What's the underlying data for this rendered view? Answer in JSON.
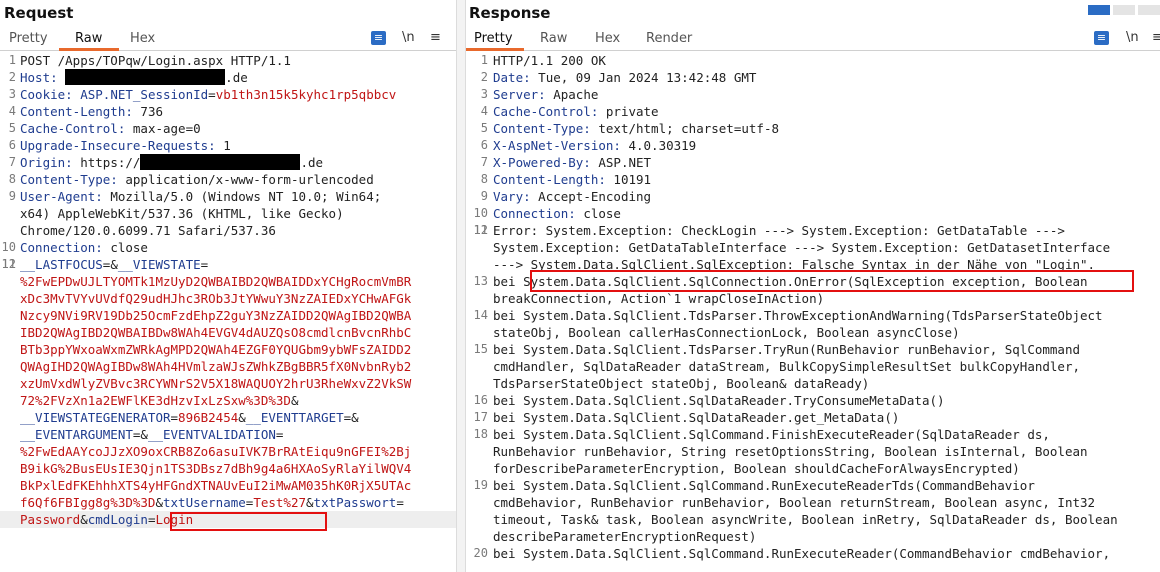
{
  "request": {
    "title": "Request",
    "tabs": [
      "Pretty",
      "Raw",
      "Hex"
    ],
    "active_tab": "Raw",
    "lines": {
      "l1": "POST /Apps/TOPqw/Login.aspx HTTP/1.1",
      "l2_name": "Host:",
      "l2_suffix": ".de",
      "l3_name": "Cookie:",
      "l3_cookie_name": "ASP.NET_SessionId",
      "l3_cookie_value": "vb1th3n15k5kyhc1rp5qbbcv",
      "l4_name": "Content-Length:",
      "l4_value": "736",
      "l5_name": "Cache-Control:",
      "l5_value": "max-age=0",
      "l6_name": "Upgrade-Insecure-Requests:",
      "l6_value": "1",
      "l7_name": "Origin:",
      "l7_prefix": "https://",
      "l7_suffix": ".de",
      "l8_name": "Content-Type:",
      "l8_value": "application/x-www-form-urlencoded",
      "l9_name": "User-Agent:",
      "l9_value_a": "Mozilla/5.0 (Windows NT 10.0; Win64;",
      "l9_value_b": "x64) AppleWebKit/537.36 (KHTML, like Gecko)",
      "l9_value_c": "Chrome/120.0.6099.71 Safari/537.36",
      "l10_name": "Connection:",
      "l10_value": "close",
      "body": {
        "lastfocus": "__LASTFOCUS",
        "viewstate_key": "__VIEWSTATE",
        "vs1": "%2FwEPDwUJLTYOMTk1MzUyD2QWBAIBD2QWBAIDDxYCHgRocmVmBR",
        "vs2": "xDc3MvTVYvUVdfQ29udHJhc3ROb3JtYWwuY3NzZAIEDxYCHwAFGk",
        "vs3": "Nzcy9NVi9RV19Db25OcmFzdEhpZ2guY3NzZAIDD2QWAgIBD2QWBA",
        "vs4": "IBD2QWAgIBD2QWBAIBDw8WAh4EVGV4dAUZQsO8cmdlcnBvcnRhbC",
        "vs5": "BTb3ppYWxoaWxmZWRkAgMPD2QWAh4EZGF0YQUGbm9ybWFsZAIDD2",
        "vs6": "QWAgIHD2QWAgIBDw8WAh4HVmlzaWJsZWhkZBgBBR5fX0NvbnRyb2",
        "vs7": "xzUmVxdWlyZVBvc3RCYWNrS2V5X18WAQUOY2hrU3RheWxvZ2VkSW",
        "vs8": "72%2FVzXn1a2EWFlKE3dHzvIxLzSxw%3D%3D",
        "vsgen_key": "__VIEWSTATEGENERATOR",
        "vsgen_value": "896B2454",
        "evtarget_key": "__EVENTTARGET",
        "evarg_key": "__EVENTARGUMENT",
        "evval_key": "__EVENTVALIDATION",
        "ev1": "%2FwEdAAYcoJJzXO9oxCRB8Zo6asuIVK7BrRAtEiqu9nGFEI%2Bj",
        "ev2": "B9ikG%2BusEUsIE3Qjn1TS3DBsz7dBh9g4a6HXAoSyRlaYilWQV4",
        "ev3": "BkPxlEdFKEhhhXTS4yHFGndXTNAUvEuI2iMwAM035hK0RjX5UTAc",
        "ev4": "f6Qf6FBIgg8g%3D%3D",
        "user_key": "txtUsername",
        "user_value": "Test%27",
        "pass_key": "txtPasswort",
        "pass_value": "Password",
        "login_key": "cmdLogin",
        "login_value": "Login"
      }
    }
  },
  "response": {
    "title": "Response",
    "tabs": [
      "Pretty",
      "Raw",
      "Hex",
      "Render"
    ],
    "active_tab": "Pretty",
    "headers": [
      {
        "n": "1",
        "text": "HTTP/1.1 200 OK"
      },
      {
        "n": "2",
        "name": "Date:",
        "value": "Tue, 09 Jan 2024 13:42:48 GMT"
      },
      {
        "n": "3",
        "name": "Server:",
        "value": "Apache"
      },
      {
        "n": "4",
        "name": "Cache-Control:",
        "value": "private"
      },
      {
        "n": "5",
        "name": "Content-Type:",
        "value": "text/html; charset=utf-8"
      },
      {
        "n": "6",
        "name": "X-AspNet-Version:",
        "value": "4.0.30319"
      },
      {
        "n": "7",
        "name": "X-Powered-By:",
        "value": "ASP.NET"
      },
      {
        "n": "8",
        "name": "Content-Length:",
        "value": "10191"
      },
      {
        "n": "9",
        "name": "Vary:",
        "value": "Accept-Encoding"
      },
      {
        "n": "10",
        "name": "Connection:",
        "value": "close"
      }
    ],
    "error_a": "Error: System.Exception: CheckLogin ---> System.Exception: GetDataTable --->",
    "error_b": "System.Exception: GetDataTableInterface ---> System.Exception: GetDatasetInterface",
    "error_c_prefix": "--->",
    "error_c_sql": "System.Data.SqlClient.SqlException: Falsche Syntax in der Nähe von \"Login\".",
    "s13a": "bei System.Data.SqlClient.SqlConnection.OnError(SqlException exception, Boolean",
    "s13b": "breakConnection, Action`1 wrapCloseInAction)",
    "s14a": "bei System.Data.SqlClient.TdsParser.ThrowExceptionAndWarning(TdsParserStateObject",
    "s14b": "stateObj, Boolean callerHasConnectionLock, Boolean asyncClose)",
    "s15a": "bei System.Data.SqlClient.TdsParser.TryRun(RunBehavior runBehavior, SqlCommand",
    "s15b": "cmdHandler, SqlDataReader dataStream, BulkCopySimpleResultSet bulkCopyHandler,",
    "s15c": "TdsParserStateObject stateObj, Boolean& dataReady)",
    "s16": "bei System.Data.SqlClient.SqlDataReader.TryConsumeMetaData()",
    "s17": "bei System.Data.SqlClient.SqlDataReader.get_MetaData()",
    "s18a": "bei System.Data.SqlClient.SqlCommand.FinishExecuteReader(SqlDataReader ds,",
    "s18b": "RunBehavior runBehavior, String resetOptionsString, Boolean isInternal, Boolean",
    "s18c": "forDescribeParameterEncryption, Boolean shouldCacheForAlwaysEncrypted)",
    "s19a": "bei System.Data.SqlClient.SqlCommand.RunExecuteReaderTds(CommandBehavior",
    "s19b": "cmdBehavior, RunBehavior runBehavior, Boolean returnStream, Boolean async, Int32",
    "s19c": "timeout, Task& task, Boolean asyncWrite, Boolean inRetry, SqlDataReader ds, Boolean",
    "s19d": "describeParameterEncryptionRequest)",
    "s20": "bei System.Data.SqlClient.SqlCommand.RunExecuteReader(CommandBehavior cmdBehavior,"
  },
  "toolbar": {
    "pretty_icon": "pretty-print-icon",
    "newline_label": "\\n",
    "menu_icon": "hamburger-menu-icon"
  },
  "colors": {
    "accent": "#e8692c",
    "header_name": "#1f3c8f",
    "param": "#c01515",
    "highlight_box": "#e31010"
  }
}
